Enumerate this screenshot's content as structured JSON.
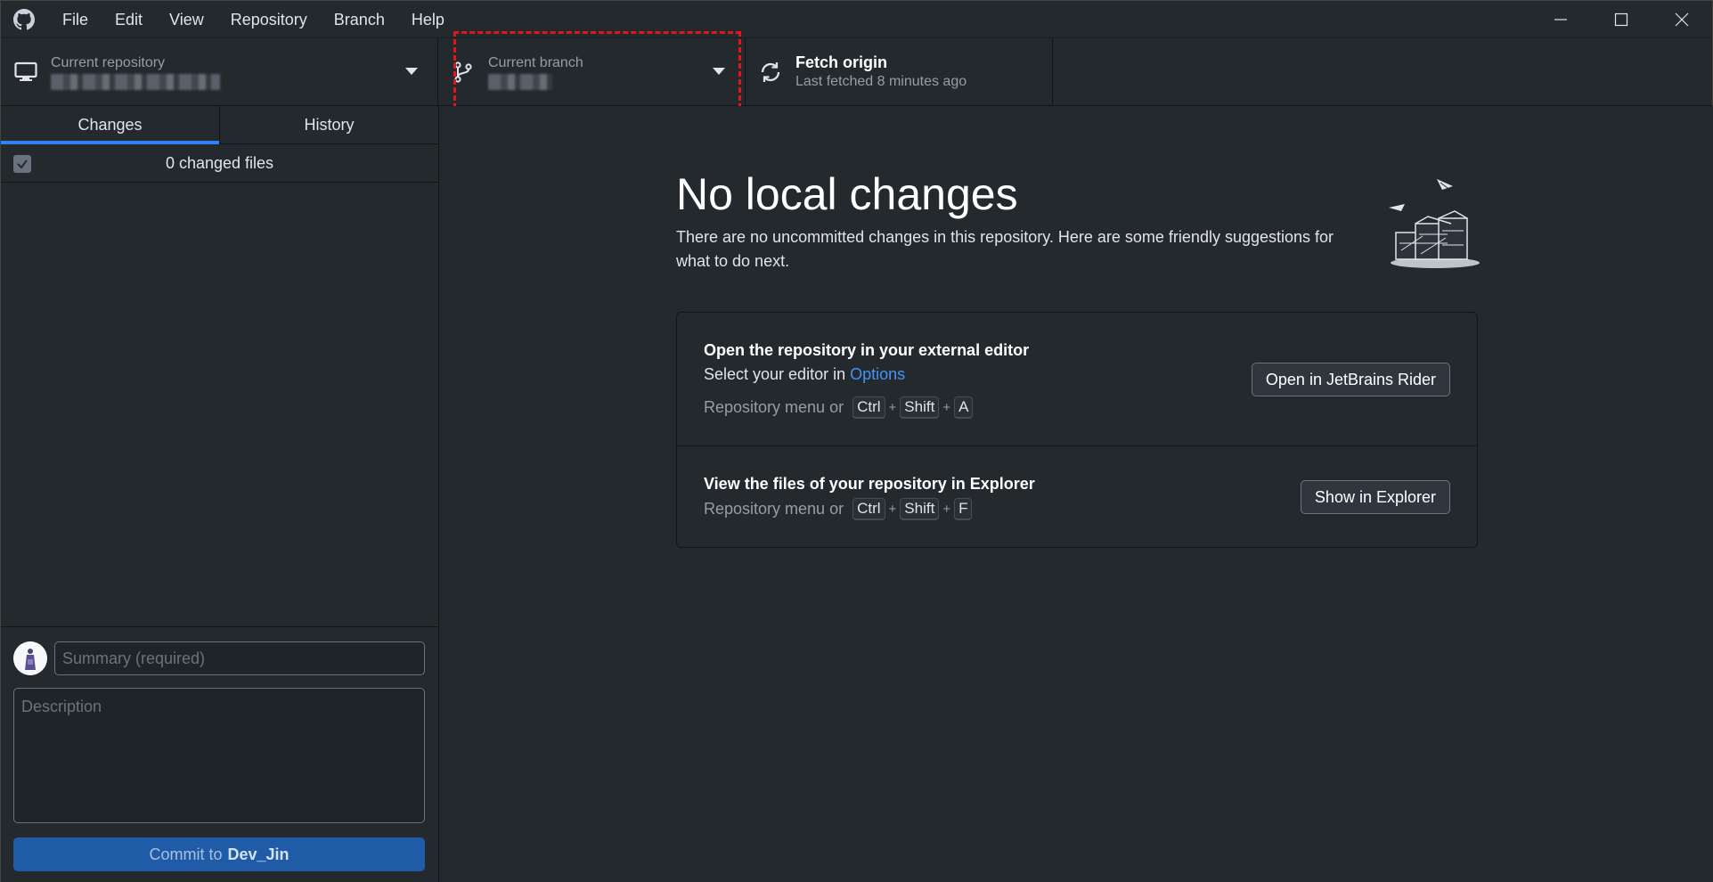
{
  "menu": {
    "items": [
      "File",
      "Edit",
      "View",
      "Repository",
      "Branch",
      "Help"
    ]
  },
  "toolbar": {
    "repo_label": "Current repository",
    "branch_label": "Current branch",
    "fetch_title": "Fetch origin",
    "fetch_sub": "Last fetched 8 minutes ago"
  },
  "sidebar": {
    "tabs": [
      "Changes",
      "History"
    ],
    "changes_count": "0 changed files",
    "summary_placeholder": "Summary (required)",
    "description_placeholder": "Description",
    "commit_prefix": "Commit to",
    "commit_branch": "Dev_Jin"
  },
  "main": {
    "title": "No local changes",
    "text": "There are no uncommitted changes in this repository. Here are some friendly suggestions for what to do next.",
    "suggestions": [
      {
        "title": "Open the repository in your external editor",
        "desc_prefix": "Select your editor in",
        "desc_link": "Options",
        "shortcut_prefix": "Repository menu or",
        "keys": [
          "Ctrl",
          "Shift",
          "A"
        ],
        "button": "Open in JetBrains Rider"
      },
      {
        "title": "View the files of your repository in Explorer",
        "shortcut_prefix": "Repository menu or",
        "keys": [
          "Ctrl",
          "Shift",
          "F"
        ],
        "button": "Show in Explorer"
      }
    ]
  },
  "colors": {
    "background": "#24292e",
    "accent": "#2f81f7",
    "commit_button": "#1f5ba6",
    "highlight": "#e0161a",
    "link": "#4493f8"
  },
  "icons": {
    "logo": "github-icon",
    "repo": "computer-icon",
    "branch": "git-branch-icon",
    "fetch": "sync-icon"
  }
}
